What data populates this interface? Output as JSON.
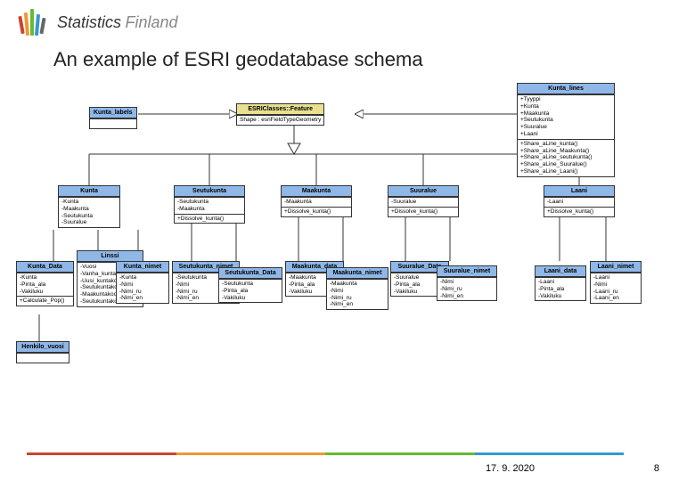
{
  "brand": {
    "main": "Statistics",
    "sub": "Finland"
  },
  "title": "An example of ESRI geodatabase schema",
  "footer": {
    "date": "17. 9. 2020",
    "page": "8"
  },
  "classes": {
    "kunta_labels": {
      "name": "Kunta_labels"
    },
    "esri_gp": {
      "name": "ESRIClasses::Feature",
      "attr": "Shape : esriFieldTypeGeometry"
    },
    "kunta_lines": {
      "name": "Kunta_lines",
      "attrs": [
        "+Tyyppi",
        "+Kunta",
        "+Maakunta",
        "+Seutukunta",
        "+Suuralue",
        "+Laani"
      ],
      "ops": [
        "+Share_aLine_kunta()",
        "+Share_aLine_Maakunta()",
        "+Share_aLine_seutukunta()",
        "+Share_aLine_Suuralue()",
        "+Share_aLine_Laani()"
      ]
    },
    "kunta": {
      "name": "Kunta",
      "attrs": [
        "-Kunta",
        "-Maakunta",
        "-Seutukunta",
        "-Suuralue"
      ]
    },
    "seutukunta": {
      "name": "Seutukunta",
      "attrs": [
        "-Seutukunta",
        "-Maakunta"
      ],
      "ops": [
        "+Dissolve_kunta()"
      ]
    },
    "maakunta": {
      "name": "Maakunta",
      "attrs": [
        "-Maakunta"
      ],
      "ops": [
        "+Dissolve_kunta()"
      ]
    },
    "suuralue": {
      "name": "Suuralue",
      "attrs": [
        "-Suuralue"
      ],
      "ops": [
        "+Dissolve_kunta()"
      ]
    },
    "laani": {
      "name": "Laani",
      "attrs": [
        "-Laani"
      ],
      "ops": [
        "+Dissolve_kunta()"
      ]
    },
    "kunta_data": {
      "name": "Kunta_Data",
      "attrs": [
        "-Kunta",
        "-Pinta_ala",
        "-Vakiluku"
      ],
      "ops": [
        "+Calculate_Pop()"
      ]
    },
    "linssi": {
      "name": "Linssi",
      "attrs": [
        "-Vuosi",
        "-Vanha_kuntakoodi",
        "-Uusi_kuntakoodi",
        "-Seutukuntakoodi",
        "-Maakuntakoodi",
        "-Seutukuntakoodi"
      ]
    },
    "kunta_nimet": {
      "name": "Kunta_nimet",
      "attrs": [
        "-Kunta",
        "-Nimi",
        "-Nimi_ru",
        "-Nimi_en"
      ]
    },
    "seutukunta_nimet": {
      "name": "Seutukunta_nimet",
      "attrs": [
        "-Seutukunta",
        "-Nimi",
        "-Nimi_ru",
        "-Nimi_en"
      ]
    },
    "seutukunta_data": {
      "name": "Seutukunta_Data",
      "attrs": [
        "-Seutukunta",
        "-Pinta_ala",
        "-Vakiluku"
      ]
    },
    "maakunta_data": {
      "name": "Maakunta_data",
      "attrs": [
        "-Maakunta",
        "-Pinta_ala",
        "-Vakiluku"
      ]
    },
    "maakunta_nimet": {
      "name": "Maakunta_nimet",
      "attrs": [
        "-Maakunta",
        "-Nimi",
        "-Nimi_ru",
        "-Nimi_en"
      ]
    },
    "suuralue_data": {
      "name": "Suuralue_Data",
      "attrs": [
        "-Suuralue",
        "-Pinta_ala",
        "-Vakiluku"
      ]
    },
    "suuralue_nimet": {
      "name": "Suuralue_nimet",
      "attrs": [
        "-Nimi",
        "-Nimi_ru",
        "-Nimi_en"
      ]
    },
    "laani_data": {
      "name": "Laani_data",
      "attrs": [
        "-Laani",
        "-Pinta_ala",
        "-Vakiluku"
      ]
    },
    "laani_nimet": {
      "name": "Laani_nimet",
      "attrs": [
        "-Laani",
        "-Nimi",
        "-Laani_ru",
        "-Laani_en"
      ]
    },
    "henkilo_vuosi": {
      "name": "Henkilo_vuosi"
    }
  }
}
